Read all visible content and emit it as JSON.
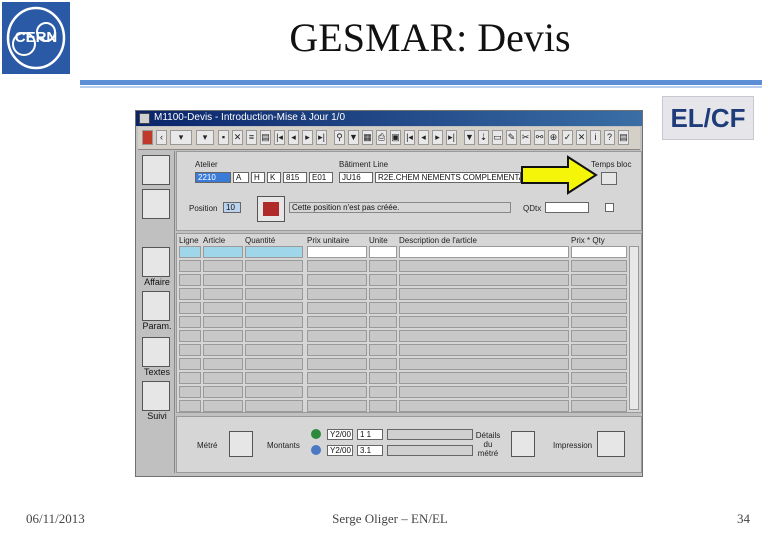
{
  "slide": {
    "title": "GESMAR: Devis",
    "tag": "EL/CF",
    "footer_left": "06/11/2013",
    "footer_center": "Serge Oliger – EN/EL",
    "footer_right": "34",
    "logo_text": "CERN"
  },
  "window": {
    "title": "M1100-Devis - Introduction-Mise à Jour 1/0",
    "left_labels": [
      "Affaire",
      "Param.",
      "Textes",
      "Suivi"
    ],
    "form": {
      "atelier_label": "Atelier",
      "atelier_values": [
        "2210",
        "A",
        "H",
        "K",
        "815",
        "E01"
      ],
      "batiment_label": "Bâtiment",
      "line_label": "Line",
      "batiment_value": "JU16",
      "line_value": "R2E.CHEM NEMENTS COMPLEMENTA",
      "bloc_label": "Temps bloc",
      "position_label": "Position",
      "position_value": "10",
      "message": "Cette position n'est pas créée.",
      "qty_label": "QDtx"
    },
    "grid_headers": [
      "Ligne",
      "Article",
      "Quantité",
      "Prix unitaire",
      "Unite",
      "Description de l'article",
      "Prix * Qty"
    ],
    "bottom": {
      "label_left": "Métré",
      "label_montant": "Montants",
      "code1": "Y2/00",
      "num1": "1 1",
      "code2": "Y2/00",
      "num2": "3.1",
      "detail_label": "Détails du métré",
      "impression_label": "Impression"
    }
  },
  "colors": {
    "title_bar": "#0a246a",
    "accent_bar": "#5b8ed4",
    "arrow": "#f5f50a",
    "selection": "#3b7bd8"
  }
}
